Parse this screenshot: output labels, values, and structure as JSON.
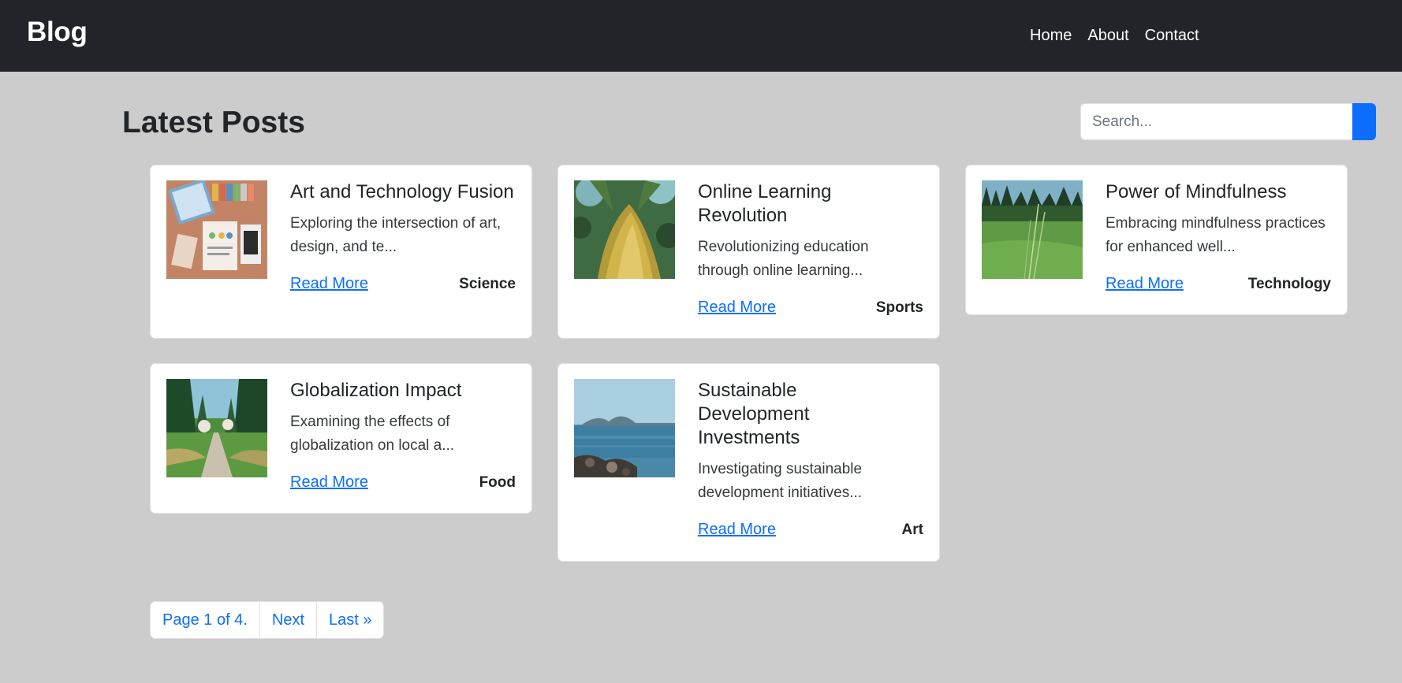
{
  "navbar": {
    "brand": "Blog",
    "links": [
      "Home",
      "About",
      "Contact"
    ]
  },
  "main": {
    "title": "Latest Posts",
    "search": {
      "placeholder": "Search...",
      "value": ""
    }
  },
  "posts": [
    {
      "title": "Art and Technology Fusion",
      "excerpt": "Exploring the intersection of art, design, and te...",
      "link": "Read More",
      "category": "Science",
      "image": "desk-workspace-photo"
    },
    {
      "title": "Online Learning Revolution",
      "excerpt": "Revolutionizing education through online learning...",
      "link": "Read More",
      "category": "Sports",
      "image": "tree-canopy-photo"
    },
    {
      "title": "Power of Mindfulness",
      "excerpt": "Embracing mindfulness practices for enhanced well...",
      "link": "Read More",
      "category": "Technology",
      "image": "grass-field-photo"
    },
    {
      "title": "Globalization Impact",
      "excerpt": "Examining the effects of globalization on local a...",
      "link": "Read More",
      "category": "Food",
      "image": "forest-path-photo"
    },
    {
      "title": "Sustainable Development Investments",
      "excerpt": "Investigating sustainable development initiatives...",
      "link": "Read More",
      "category": "Art",
      "image": "lake-shore-photo"
    }
  ],
  "pagination": {
    "status": "Page 1 of 4.",
    "next": "Next",
    "last": "Last »"
  },
  "colors": {
    "navbar": "#212529",
    "background": "#cccccc",
    "accent": "#0d6efd"
  }
}
